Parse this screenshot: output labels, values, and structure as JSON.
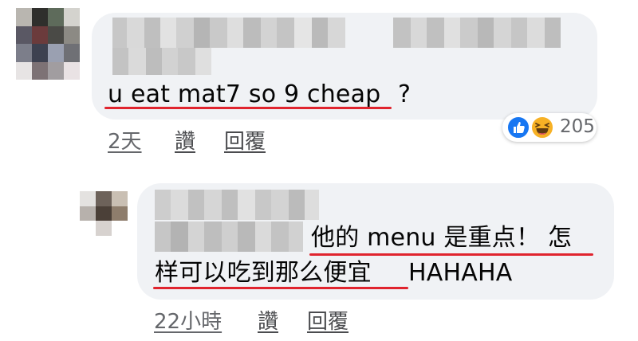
{
  "colors": {
    "bubble": "#f0f2f5",
    "meta_text": "#65676b",
    "underline": "#e0242e",
    "like_blue": "#1877f2",
    "haha_yellow": "#f7b125"
  },
  "comment1": {
    "text": "u eat mat7 so 9 cheap",
    "question_mark": "?",
    "time": "2天",
    "like_label": "讚",
    "reply_label": "回覆",
    "reactions": {
      "icons": [
        "like-icon",
        "haha-icon"
      ],
      "count": "205"
    }
  },
  "comment2": {
    "line1_text": "他的 menu 是重点！ 怎",
    "line2_underlined": "样可以吃到那么便宜",
    "line2_rest": "HAHAHA",
    "time": "22小時",
    "like_label": "讚",
    "reply_label": "回覆"
  }
}
